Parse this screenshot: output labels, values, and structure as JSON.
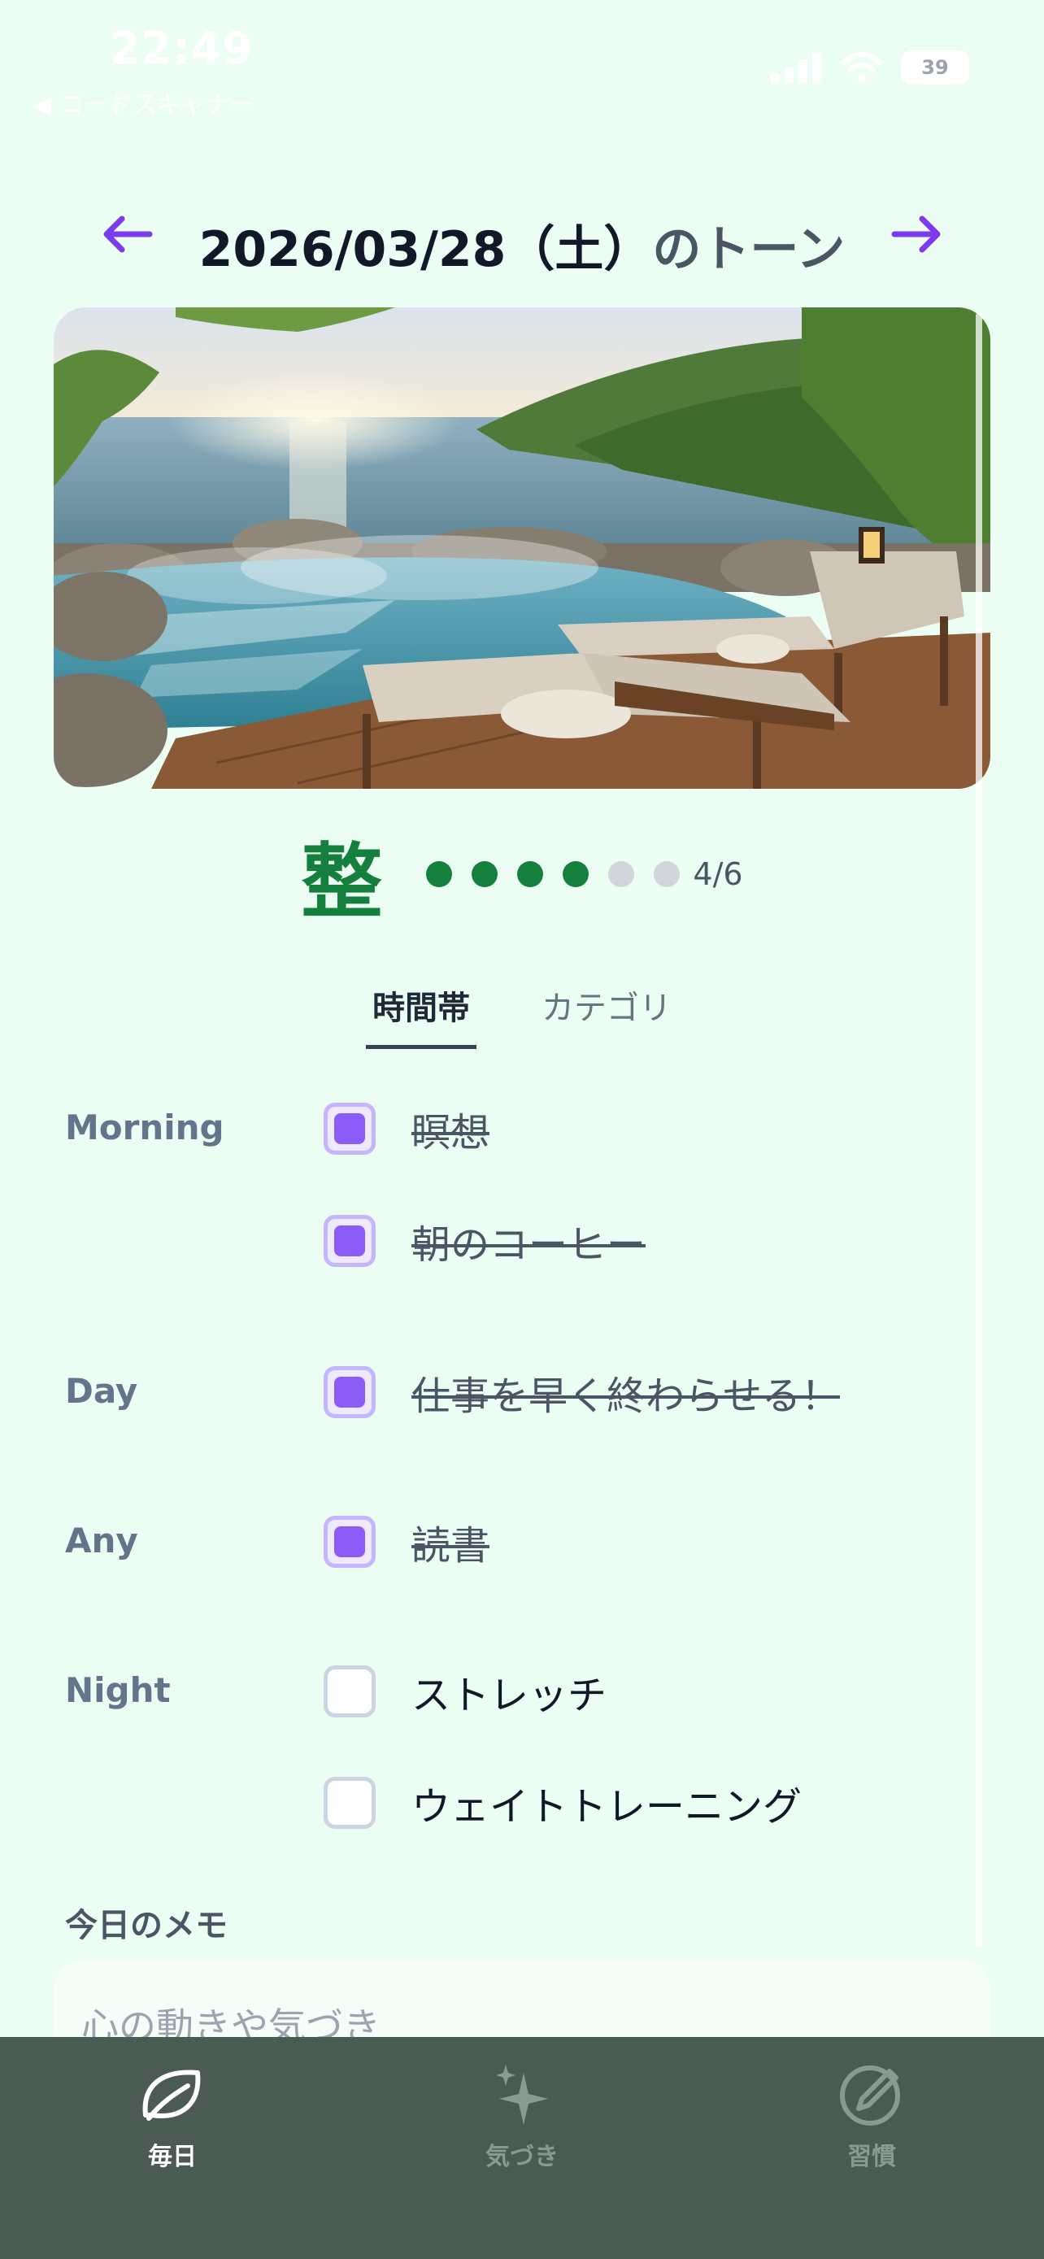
{
  "status_bar": {
    "time": "22:49",
    "back_label": "◀ コードスキャナー",
    "battery": "39"
  },
  "header": {
    "date": "2026/03/28（土）",
    "suffix": "のトーン"
  },
  "hero_image": {
    "alt_name": "onsen-ocean-view"
  },
  "tone": {
    "kanji": "整",
    "filled": 4,
    "total": 6,
    "count_label": "4/6"
  },
  "tabs": [
    {
      "label": "時間帯",
      "active": true
    },
    {
      "label": "カテゴリ",
      "active": false
    }
  ],
  "groups": {
    "morning": "Morning",
    "day": "Day",
    "any": "Any",
    "night": "Night"
  },
  "tasks": [
    {
      "label": "瞑想",
      "done": true
    },
    {
      "label": "朝のコーヒー",
      "done": true
    },
    {
      "label": "仕事を早く終わらせる！",
      "done": true
    },
    {
      "label": "読書",
      "done": true
    },
    {
      "label": "ストレッチ",
      "done": false
    },
    {
      "label": "ウェイトトレーニング",
      "done": false
    }
  ],
  "memo": {
    "title": "今日のメモ",
    "placeholder": "心の動きや気づき"
  },
  "tabbar": [
    {
      "label": "毎日",
      "icon": "leaf-icon",
      "active": true
    },
    {
      "label": "気づき",
      "icon": "sparkle-icon",
      "active": false
    },
    {
      "label": "習慣",
      "icon": "pencil-circle-icon",
      "active": false
    }
  ],
  "colors": {
    "background": "#ecfdf4",
    "accent": "#7c3aed",
    "tone_green": "#15803d",
    "checkbox_fill": "#8b5cf6",
    "tabbar": "#4b5a53"
  }
}
